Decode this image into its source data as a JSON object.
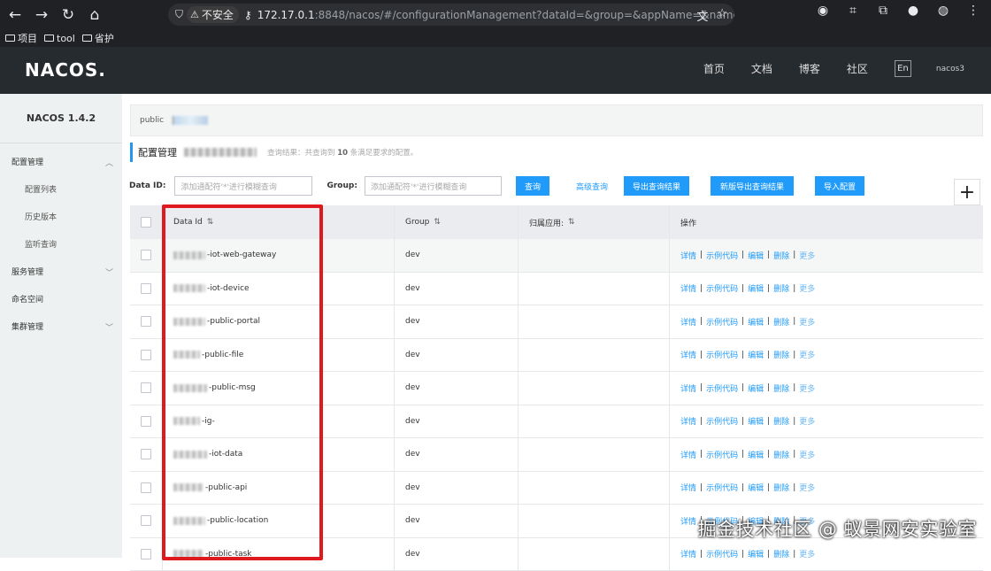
{
  "browser": {
    "url_host": "172.17.0.1",
    "url_rest": ":8848/nacos/#/configurationManagement?dataId=&group=&appName=&names",
    "insecure_label": "不安全",
    "bookmarks": [
      "项目",
      "tool",
      "省护"
    ]
  },
  "header": {
    "logo": "NACOS.",
    "nav": [
      "首页",
      "文档",
      "博客",
      "社区"
    ],
    "lang": "En",
    "user": "nacos3"
  },
  "sidebar": {
    "version": "NACOS 1.4.2",
    "items": [
      {
        "label": "配置管理"
      },
      {
        "label": "配置列表"
      },
      {
        "label": "历史版本"
      },
      {
        "label": "监听查询"
      },
      {
        "label": "服务管理"
      },
      {
        "label": "命名空间"
      },
      {
        "label": "集群管理"
      }
    ]
  },
  "namespace": {
    "label": "public"
  },
  "page": {
    "title": "配置管理",
    "result_prefix": "查询结果：共查询到",
    "result_count": "10",
    "result_suffix": "条满足要求的配置。"
  },
  "filter": {
    "dataid_label": "Data ID:",
    "dataid_placeholder": "添加通配符'*'进行模糊查询",
    "group_label": "Group:",
    "group_placeholder": "添加通配符'*'进行模糊查询",
    "query_btn": "查询",
    "advanced_link": "高级查询",
    "export_btn": "导出查询结果",
    "export_new_btn": "新版导出查询结果",
    "import_btn": "导入配置",
    "add_btn": "+"
  },
  "table": {
    "headers": {
      "data_id": "Data Id",
      "group": "Group",
      "app": "归属应用:",
      "ops": "操作"
    },
    "sort_icon": "⇅",
    "ops": {
      "detail": "详情",
      "sample": "示例代码",
      "edit": "编辑",
      "delete": "删除",
      "more": "更多",
      "sep": "|"
    },
    "rows": [
      {
        "data_id": "-iot-web-gateway",
        "group": "dev"
      },
      {
        "data_id": "-iot-device",
        "group": "dev"
      },
      {
        "data_id": "-public-portal",
        "group": "dev"
      },
      {
        "data_id": "-public-file",
        "group": "dev"
      },
      {
        "data_id": "-public-msg",
        "group": "dev"
      },
      {
        "data_id": "-ig-",
        "group": "dev"
      },
      {
        "data_id": "-iot-data",
        "group": "dev"
      },
      {
        "data_id": "-public-api",
        "group": "dev"
      },
      {
        "data_id": "-public-location",
        "group": "dev"
      },
      {
        "data_id": "-public-task",
        "group": "dev"
      }
    ]
  },
  "watermark": "掘金技术社区 @ 蚁景网安实验室",
  "colors": {
    "accent": "#209bfa",
    "header_bg": "#262b2f",
    "highlight": "#e0191f"
  }
}
